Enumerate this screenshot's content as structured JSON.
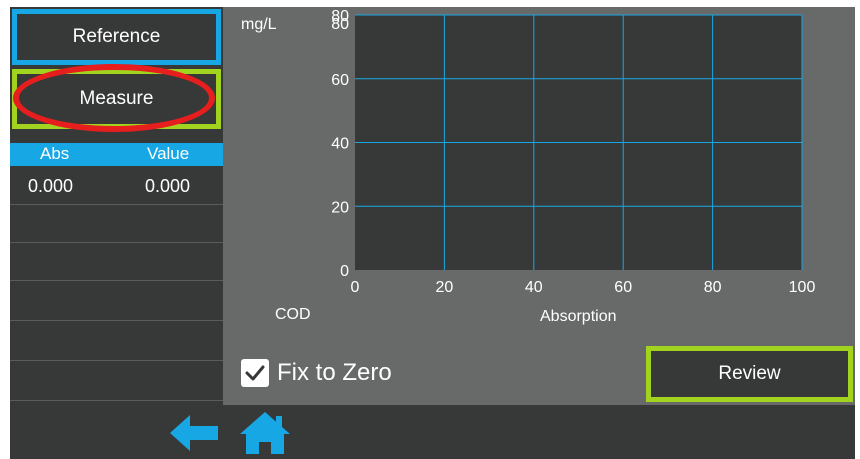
{
  "buttons": {
    "reference": "Reference",
    "measure": "Measure",
    "review": "Review"
  },
  "table": {
    "headers": [
      "Abs",
      "Value"
    ],
    "rows": [
      {
        "abs": "0.000",
        "value": "0.000"
      },
      {
        "abs": "",
        "value": ""
      },
      {
        "abs": "",
        "value": ""
      },
      {
        "abs": "",
        "value": ""
      },
      {
        "abs": "",
        "value": ""
      },
      {
        "abs": "",
        "value": ""
      }
    ]
  },
  "checkbox": {
    "label": "Fix to Zero",
    "checked": true
  },
  "icons": {
    "back": "arrow-left-icon",
    "home": "home-icon"
  },
  "colors": {
    "accent_blue": "#18a7e5",
    "accent_green": "#a2d41f",
    "highlight_red": "#e61e1e",
    "panel_dark": "#373838",
    "panel_mid": "#676a69"
  },
  "chart_data": {
    "type": "line",
    "unit_label": "mg/L",
    "ylabel": "COD",
    "xlabel": "Absorption",
    "x_ticks": [
      "0",
      "20",
      "40",
      "60",
      "80",
      "100"
    ],
    "y_ticks": [
      "0",
      "20",
      "40",
      "60",
      "80",
      "80"
    ],
    "xlim": [
      0,
      100
    ],
    "ylim": [
      0,
      80
    ],
    "grid": true,
    "series": []
  }
}
